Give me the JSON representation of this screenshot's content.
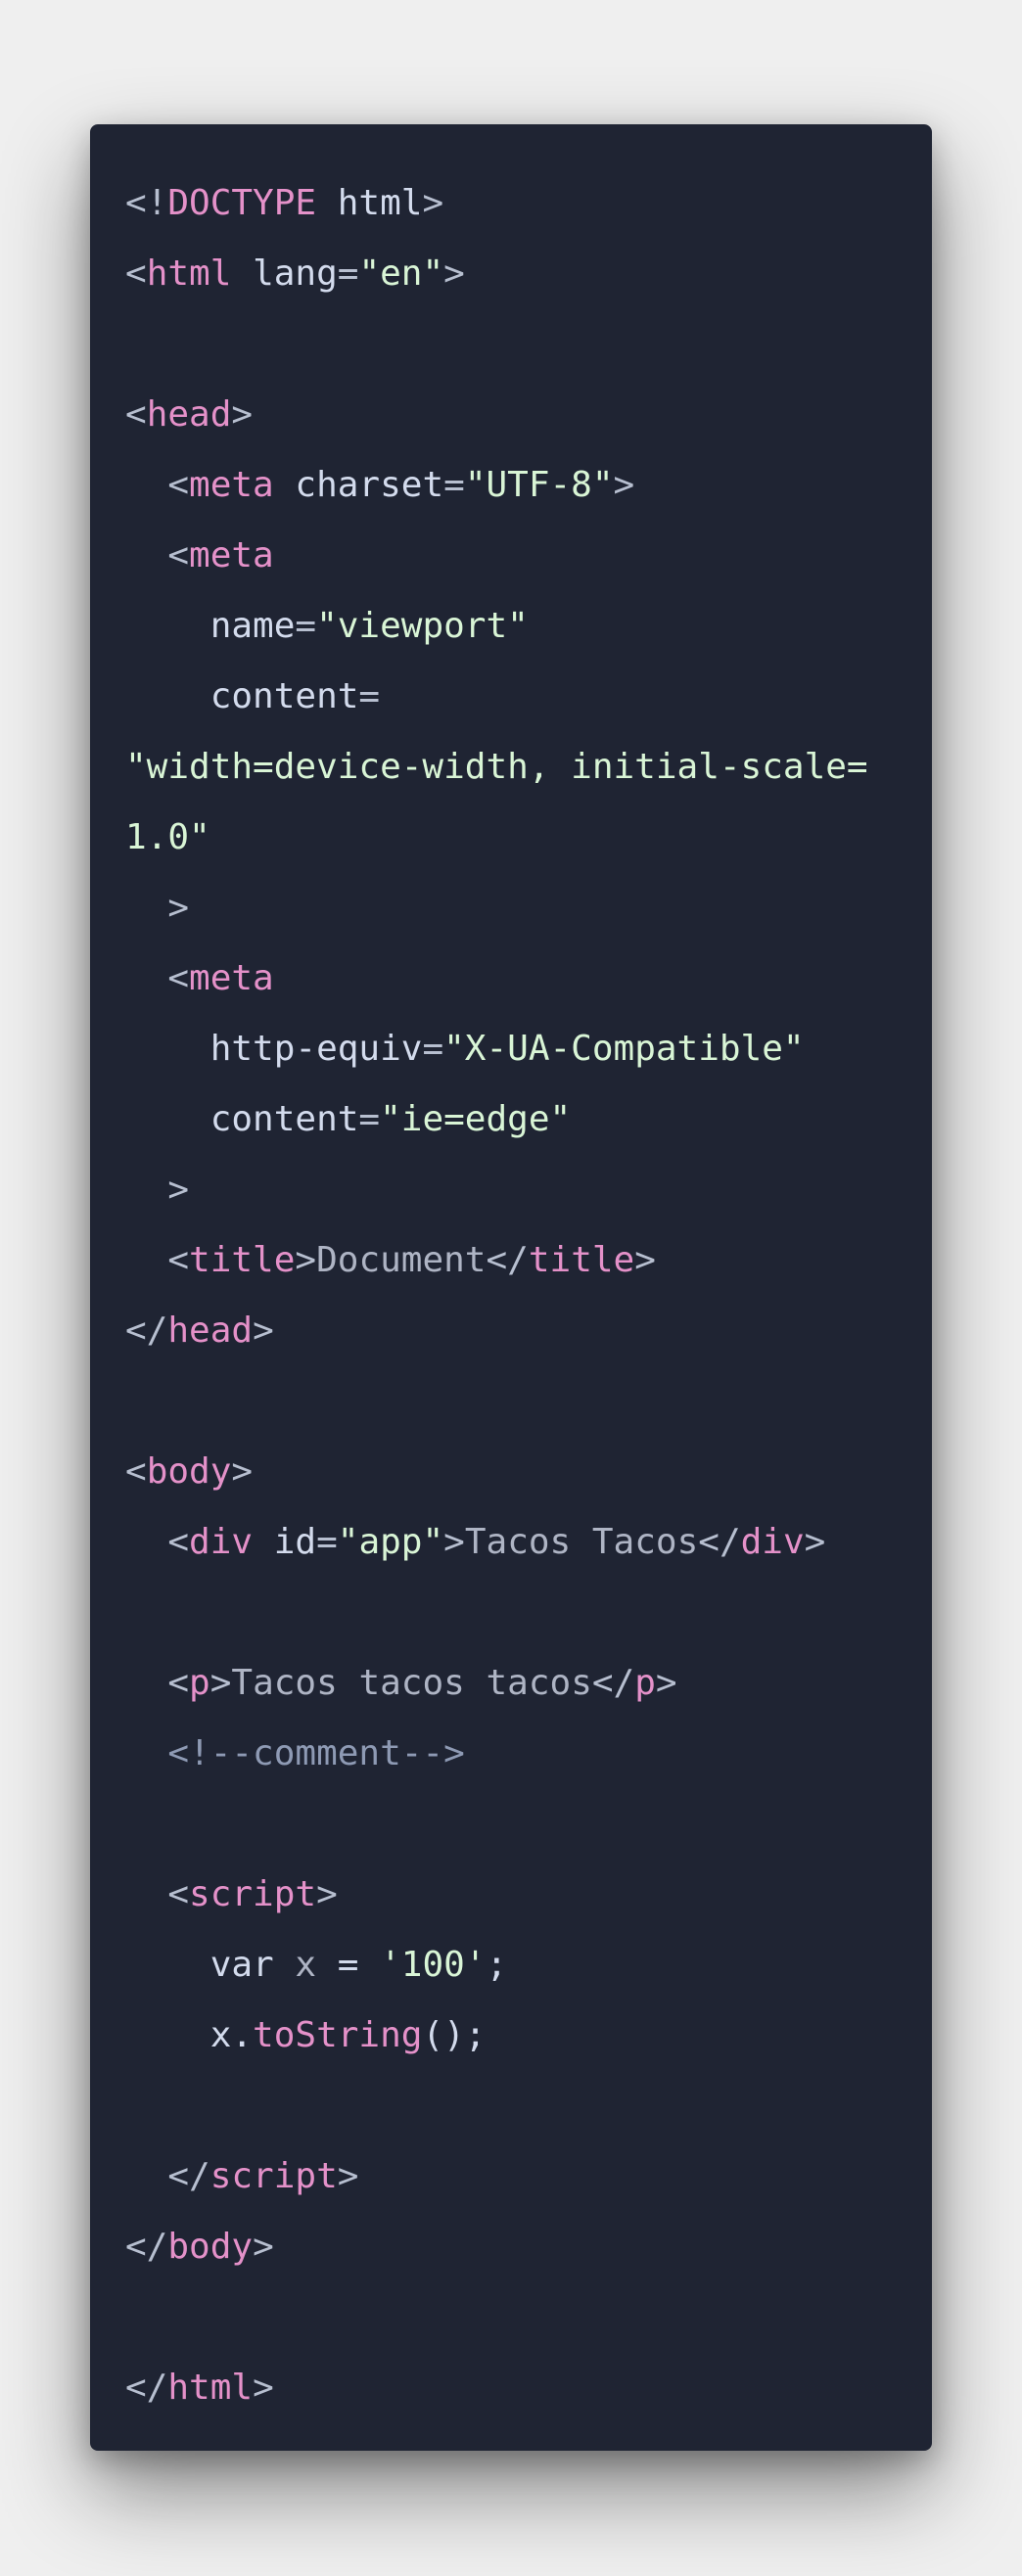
{
  "code_lines": [
    [
      {
        "t": "p",
        "v": "<!"
      },
      {
        "t": "tag",
        "v": "DOCTYPE"
      },
      {
        "t": "attr",
        "v": " html"
      },
      {
        "t": "p",
        "v": ">"
      }
    ],
    [
      {
        "t": "p",
        "v": "<"
      },
      {
        "t": "tag",
        "v": "html"
      },
      {
        "t": "attr",
        "v": " lang"
      },
      {
        "t": "p",
        "v": "="
      },
      {
        "t": "str",
        "v": "\"en\""
      },
      {
        "t": "p",
        "v": ">"
      }
    ],
    [],
    [
      {
        "t": "p",
        "v": "<"
      },
      {
        "t": "tag",
        "v": "head"
      },
      {
        "t": "p",
        "v": ">"
      }
    ],
    [
      {
        "t": "p",
        "v": "  <"
      },
      {
        "t": "tag",
        "v": "meta"
      },
      {
        "t": "attr",
        "v": " charset"
      },
      {
        "t": "p",
        "v": "="
      },
      {
        "t": "str",
        "v": "\"UTF-8\""
      },
      {
        "t": "p",
        "v": ">"
      }
    ],
    [
      {
        "t": "p",
        "v": "  <"
      },
      {
        "t": "tag",
        "v": "meta"
      }
    ],
    [
      {
        "t": "attr",
        "v": "    name"
      },
      {
        "t": "p",
        "v": "="
      },
      {
        "t": "str",
        "v": "\"viewport\""
      }
    ],
    [
      {
        "t": "attr",
        "v": "    content"
      },
      {
        "t": "p",
        "v": "="
      }
    ],
    [
      {
        "t": "str",
        "v": "\"width=device-width, initial-scale="
      }
    ],
    [
      {
        "t": "str",
        "v": "1.0\""
      }
    ],
    [
      {
        "t": "p",
        "v": "  >"
      }
    ],
    [
      {
        "t": "p",
        "v": "  <"
      },
      {
        "t": "tag",
        "v": "meta"
      }
    ],
    [
      {
        "t": "attr",
        "v": "    http-equiv"
      },
      {
        "t": "p",
        "v": "="
      },
      {
        "t": "str",
        "v": "\"X-UA-Compatible\""
      }
    ],
    [
      {
        "t": "attr",
        "v": "    content"
      },
      {
        "t": "p",
        "v": "="
      },
      {
        "t": "str",
        "v": "\"ie=edge\""
      }
    ],
    [
      {
        "t": "p",
        "v": "  >"
      }
    ],
    [
      {
        "t": "p",
        "v": "  <"
      },
      {
        "t": "tag",
        "v": "title"
      },
      {
        "t": "p",
        "v": ">"
      },
      {
        "t": "txt",
        "v": "Document"
      },
      {
        "t": "p",
        "v": "</"
      },
      {
        "t": "tag",
        "v": "title"
      },
      {
        "t": "p",
        "v": ">"
      }
    ],
    [
      {
        "t": "p",
        "v": "</"
      },
      {
        "t": "tag",
        "v": "head"
      },
      {
        "t": "p",
        "v": ">"
      }
    ],
    [],
    [
      {
        "t": "p",
        "v": "<"
      },
      {
        "t": "tag",
        "v": "body"
      },
      {
        "t": "p",
        "v": ">"
      }
    ],
    [
      {
        "t": "p",
        "v": "  <"
      },
      {
        "t": "tag",
        "v": "div"
      },
      {
        "t": "attr",
        "v": " id"
      },
      {
        "t": "p",
        "v": "="
      },
      {
        "t": "str",
        "v": "\"app\""
      },
      {
        "t": "p",
        "v": ">"
      },
      {
        "t": "txt",
        "v": "Tacos Tacos"
      },
      {
        "t": "p",
        "v": "</"
      },
      {
        "t": "tag",
        "v": "div"
      },
      {
        "t": "p",
        "v": ">"
      }
    ],
    [],
    [
      {
        "t": "p",
        "v": "  <"
      },
      {
        "t": "tag",
        "v": "p"
      },
      {
        "t": "p",
        "v": ">"
      },
      {
        "t": "txt",
        "v": "Tacos tacos tacos"
      },
      {
        "t": "p",
        "v": "</"
      },
      {
        "t": "tag",
        "v": "p"
      },
      {
        "t": "p",
        "v": ">"
      }
    ],
    [
      {
        "t": "cmt",
        "v": "  <!--comment-->"
      }
    ],
    [],
    [
      {
        "t": "p",
        "v": "  <"
      },
      {
        "t": "tag",
        "v": "script"
      },
      {
        "t": "p",
        "v": ">"
      }
    ],
    [
      {
        "t": "attr",
        "v": "    var"
      },
      {
        "t": "txt",
        "v": " x"
      },
      {
        "t": "attr",
        "v": " = "
      },
      {
        "t": "str",
        "v": "'100'"
      },
      {
        "t": "attr",
        "v": ";"
      }
    ],
    [
      {
        "t": "attr",
        "v": "    x."
      },
      {
        "t": "fn",
        "v": "toString"
      },
      {
        "t": "attr",
        "v": "();"
      }
    ],
    [],
    [
      {
        "t": "p",
        "v": "  </"
      },
      {
        "t": "tag",
        "v": "script"
      },
      {
        "t": "p",
        "v": ">"
      }
    ],
    [
      {
        "t": "p",
        "v": "</"
      },
      {
        "t": "tag",
        "v": "body"
      },
      {
        "t": "p",
        "v": ">"
      }
    ],
    [],
    [
      {
        "t": "p",
        "v": "</"
      },
      {
        "t": "tag",
        "v": "html"
      },
      {
        "t": "p",
        "v": ">"
      }
    ]
  ],
  "colors": {
    "page_background": "#efefef",
    "code_background": "#1f2433",
    "punctuation": "#b7bfd0",
    "tag_name": "#e491c9",
    "attribute": "#d3dbed",
    "string": "#d9f5d6",
    "text": "#aeb4c4",
    "comment": "#8e9ab4"
  }
}
